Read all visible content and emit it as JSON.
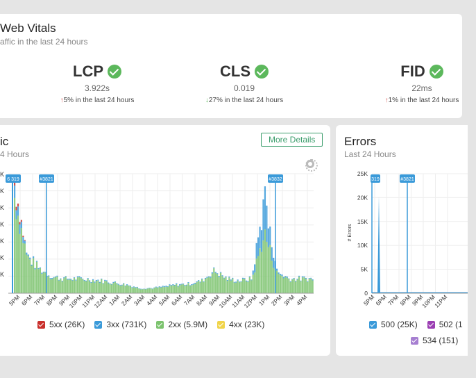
{
  "vitals": {
    "title": "Web Vitals",
    "subtitle": "affic in the last 24 hours",
    "metrics": [
      {
        "name": "LCP",
        "value": "3.922s",
        "change": "5% in the last 24 hours",
        "dir": "up"
      },
      {
        "name": "CLS",
        "value": "0.019",
        "change": "27% in the last 24 hours",
        "dir": "down"
      },
      {
        "name": "FID",
        "value": "22ms",
        "change": "1% in the last 24 hours",
        "dir": "up"
      }
    ]
  },
  "traffic": {
    "title": "ic",
    "subtitle": "4 Hours",
    "more_label": "More Details"
  },
  "errors": {
    "title": "Errors",
    "subtitle": "Last 24 Hours"
  },
  "colors": {
    "c5xx": "#c9302c",
    "c3xx": "#3a9ad9",
    "c2xx": "#7cc36e",
    "c4xx": "#f0d44a",
    "c500": "#3a9ad9",
    "c502": "#9b3fb3",
    "c534": "#a67fd1"
  },
  "chart_data": [
    {
      "type": "bar",
      "title": "",
      "xlabel": "",
      "ylabel": "",
      "categories": [
        "5PM",
        "6PM",
        "7PM",
        "8PM",
        "9PM",
        "10PM",
        "11PM",
        "12AM",
        "1AM",
        "2AM",
        "3AM",
        "4AM",
        "5AM",
        "6AM",
        "7AM",
        "8AM",
        "9AM",
        "10AM",
        "11AM",
        "12PM",
        "1PM",
        "2PM",
        "3PM",
        "4PM"
      ],
      "series": [
        {
          "name": "5xx (26K)",
          "color": "#c9302c",
          "values": [
            0.1,
            0,
            0,
            0,
            0,
            0,
            0,
            0,
            0,
            0,
            0,
            0,
            0,
            0,
            0,
            0,
            0,
            0,
            0,
            0,
            0,
            0,
            0,
            0
          ]
        },
        {
          "name": "3xx (731K)",
          "color": "#3a9ad9",
          "values": [
            0.3,
            0.05,
            0.02,
            0.02,
            0.02,
            0.02,
            0.02,
            0.02,
            0.02,
            0.02,
            0.01,
            0.01,
            0.02,
            0.02,
            0.02,
            0.02,
            0.03,
            0.02,
            0.02,
            0.02,
            0.9,
            0.05,
            0.02,
            0.02
          ]
        },
        {
          "name": "2xx (5.9M)",
          "color": "#7cc36e",
          "values": [
            2.4,
            0.9,
            0.6,
            0.4,
            0.35,
            0.35,
            0.33,
            0.3,
            0.25,
            0.2,
            0.12,
            0.12,
            0.15,
            0.2,
            0.22,
            0.3,
            0.55,
            0.35,
            0.3,
            0.35,
            1.5,
            0.5,
            0.35,
            0.35
          ]
        },
        {
          "name": "4xx (23K)",
          "color": "#f0d44a",
          "values": [
            0,
            0,
            0,
            0,
            0,
            0,
            0,
            0,
            0,
            0,
            0,
            0,
            0,
            0,
            0,
            0,
            0,
            0,
            0,
            0,
            0,
            0,
            0,
            0
          ]
        }
      ],
      "annotations": [
        "6 319",
        "#3821",
        "#3832"
      ],
      "legend": "bottom"
    },
    {
      "type": "bar",
      "title": "",
      "xlabel": "",
      "ylabel": "# Errors",
      "y_ticks": [
        "0",
        "5K",
        "10K",
        "15K",
        "20K",
        "25K"
      ],
      "ylim": [
        0,
        25000
      ],
      "categories": [
        "5PM",
        "6PM",
        "7PM",
        "8PM",
        "9PM",
        "10PM",
        "11PM"
      ],
      "series": [
        {
          "name": "500 (25K)",
          "color": "#3a9ad9",
          "values": [
            20300,
            0,
            0,
            0,
            0,
            0,
            0
          ]
        },
        {
          "name": "502 (1",
          "color": "#9b3fb3",
          "values": [
            0,
            0,
            0,
            0,
            0,
            0,
            0
          ]
        },
        {
          "name": "534 (151)",
          "color": "#a67fd1",
          "values": [
            0,
            0,
            0,
            0,
            0,
            0,
            0
          ]
        }
      ],
      "annotations": [
        "319",
        "#3821"
      ],
      "legend": "bottom"
    }
  ]
}
